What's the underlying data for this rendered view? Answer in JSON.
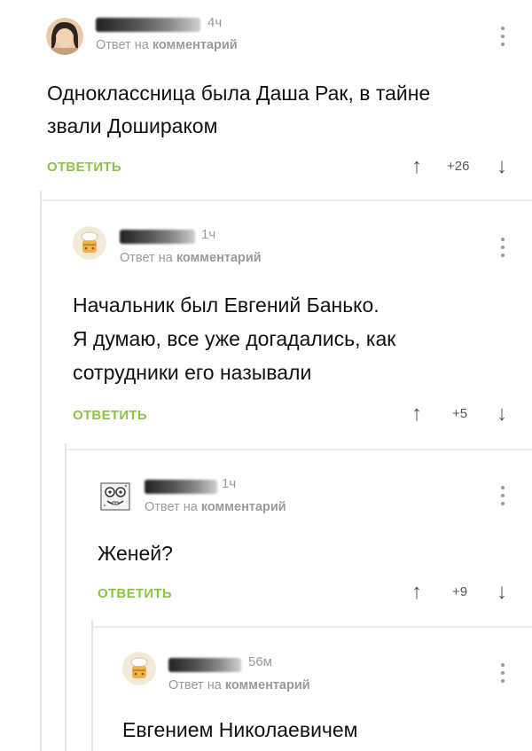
{
  "comments": [
    {
      "time": "4ч",
      "reply_prefix": "Ответ на",
      "reply_target": "комментарий",
      "text_lines": [
        "Одноклассница была Даша Рак, в тайне",
        "звали Дошираком"
      ],
      "reply_label": "ОТВЕТИТЬ",
      "score": "+26",
      "up_icon": "↑",
      "down_icon": "↓"
    },
    {
      "time": "1ч",
      "reply_prefix": "Ответ на",
      "reply_target": "комментарий",
      "text_lines": [
        "Начальник был Евгений Банько.",
        "Я думаю, все уже догадались, как",
        "сотрудники его называли"
      ],
      "reply_label": "ОТВЕТИТЬ",
      "score": "+5",
      "up_icon": "↑",
      "down_icon": "↓"
    },
    {
      "time": "1ч",
      "reply_prefix": "Ответ на",
      "reply_target": "комментарий",
      "text_lines": [
        "Женей?"
      ],
      "reply_label": "ОТВЕТИТЬ",
      "score": "+9",
      "up_icon": "↑",
      "down_icon": "↓"
    },
    {
      "time": "56м",
      "reply_prefix": "Ответ на",
      "reply_target": "комментарий",
      "text_lines": [
        "Евгением Николаевичем"
      ]
    }
  ],
  "colors": {
    "accent": "#8bc34a",
    "muted": "#9a9a9a",
    "text": "#111111"
  }
}
